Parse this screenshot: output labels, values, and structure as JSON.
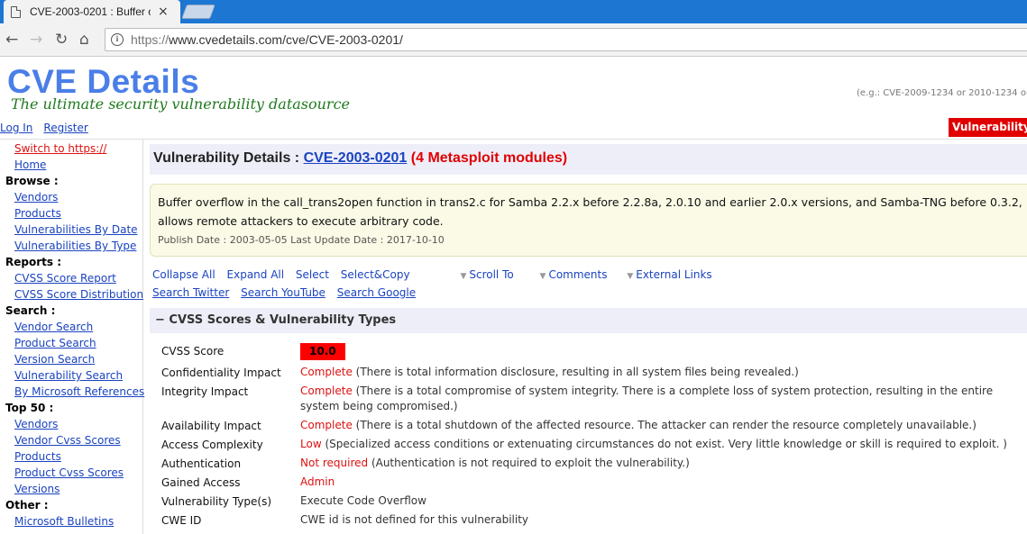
{
  "browser": {
    "tab_title": "CVE-2003-0201 : Buffer o",
    "close_glyph": "×",
    "url_scheme": "https://",
    "url_rest": "www.cvedetails.com/cve/CVE-2003-0201/"
  },
  "site": {
    "logo": "CVE Details",
    "tagline": "The ultimate security vulnerability datasource",
    "search_example": "(e.g.: CVE-2009-1234 or 2010-1234 or 20",
    "login": "Log In",
    "register": "Register",
    "vuln_button": "Vulnerability"
  },
  "sidebar": {
    "switch_https": "Switch to https://",
    "home": "Home",
    "browse_head": "Browse :",
    "vendors": "Vendors",
    "products": "Products",
    "vulns_by_date": "Vulnerabilities By Date",
    "vulns_by_type": "Vulnerabilities By Type",
    "reports_head": "Reports :",
    "cvss_report": "CVSS Score Report",
    "cvss_dist": "CVSS Score Distribution",
    "search_head": "Search :",
    "vendor_search": "Vendor Search",
    "product_search": "Product Search",
    "version_search": "Version Search",
    "vuln_search": "Vulnerability Search",
    "ms_refs": "By Microsoft References",
    "top50_head": "Top 50 :",
    "top_vendors": "Vendors",
    "vendor_cvss": "Vendor Cvss Scores",
    "top_products": "Products",
    "product_cvss": "Product Cvss Scores",
    "versions": "Versions",
    "other_head": "Other :",
    "ms_bulletins": "Microsoft Bulletins"
  },
  "main": {
    "title_prefix": "Vulnerability Details : ",
    "cve_id": "CVE-2003-0201",
    "metasploit": "(4 Metasploit modules)",
    "description": "Buffer overflow in the call_trans2open function in trans2.c for Samba 2.2.x before 2.2.8a, 2.0.10 and earlier 2.0.x versions, and Samba-TNG before 0.3.2, allows remote attackers to execute arbitrary code.",
    "dates": "Publish Date : 2003-05-05 Last Update Date : 2017-10-10",
    "actions": {
      "collapse_all": "Collapse All",
      "expand_all": "Expand All",
      "select": "Select",
      "select_copy": "Select&Copy",
      "scroll_to": "Scroll To",
      "comments": "Comments",
      "external_links": "External Links",
      "search_twitter": "Search Twitter",
      "search_youtube": "Search YouTube",
      "search_google": "Search Google",
      "dropdown_glyph": "▼"
    },
    "section_title": "− CVSS Scores & Vulnerability Types",
    "cvss": {
      "score_label": "CVSS Score",
      "score": "10.0",
      "conf_label": "Confidentiality Impact",
      "conf_value": "Complete",
      "conf_desc": " (There is total information disclosure, resulting in all system files being revealed.)",
      "integ_label": "Integrity Impact",
      "integ_value": "Complete",
      "integ_desc": " (There is a total compromise of system integrity. There is a complete loss of system protection, resulting in the entire system being compromised.)",
      "avail_label": "Availability Impact",
      "avail_value": "Complete",
      "avail_desc": " (There is a total shutdown of the affected resource. The attacker can render the resource completely unavailable.)",
      "ac_label": "Access Complexity",
      "ac_value": "Low",
      "ac_desc": " (Specialized access conditions or extenuating circumstances do not exist. Very little knowledge or skill is required to exploit. )",
      "auth_label": "Authentication",
      "auth_value": "Not required",
      "auth_desc": " (Authentication is not required to exploit the vulnerability.)",
      "gained_label": "Gained Access",
      "gained_value": "Admin",
      "type_label": "Vulnerability Type(s)",
      "type_value": "Execute Code Overflow",
      "cwe_label": "CWE ID",
      "cwe_value": "CWE id is not defined for this vulnerability"
    }
  }
}
